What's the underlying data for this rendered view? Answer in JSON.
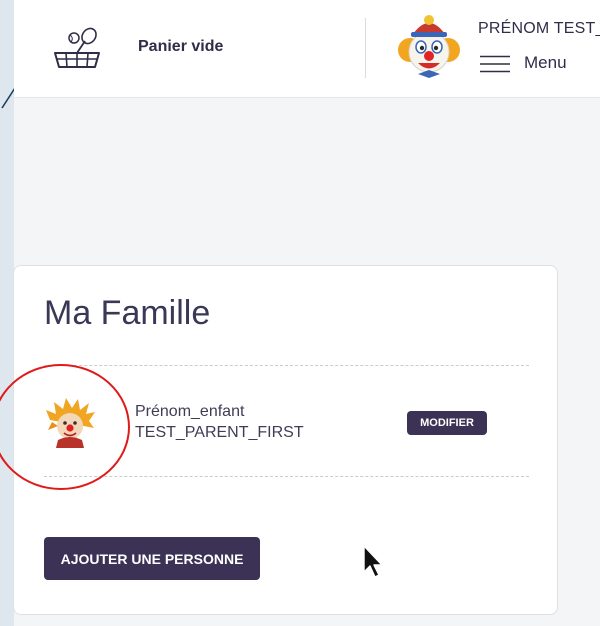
{
  "header": {
    "cart_label": "Panier vide",
    "user_name": "PRÉNOM TEST_",
    "menu_label": "Menu"
  },
  "family": {
    "title": "Ma Famille",
    "members": [
      {
        "first_name": "Prénom_enfant",
        "last_name": "TEST_PARENT_FIRST",
        "modify_label": "MODIFIER"
      }
    ],
    "add_person_label": "AJOUTER UNE PERSONNE"
  },
  "icons": {
    "cart": "basket-icon",
    "menu": "hamburger-menu-icon",
    "user_avatar": "clown-avatar-icon",
    "member_avatar": "child-clown-avatar-icon",
    "cursor": "mouse-cursor-icon"
  },
  "colors": {
    "primary_button": "#3b3256",
    "text_dark": "#2f2d48",
    "annotation": "#e01919",
    "page_background": "#f3f5f7"
  }
}
